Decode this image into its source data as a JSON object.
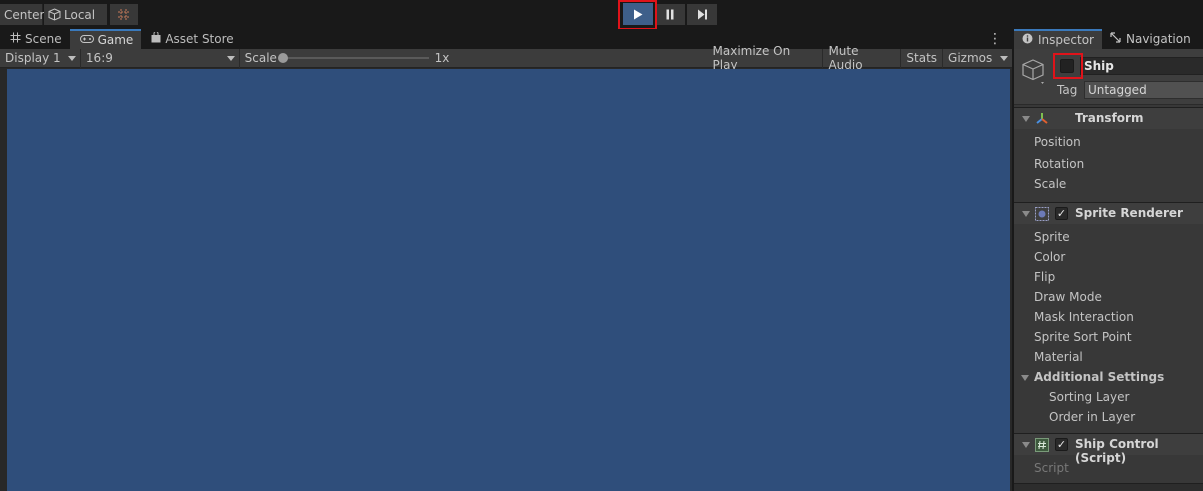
{
  "toolbar": {
    "pivot_label": "Center",
    "space_label": "Local",
    "play_state": "playing"
  },
  "game_view": {
    "tabs": [
      {
        "label": "Scene",
        "icon": "grid-icon"
      },
      {
        "label": "Game",
        "icon": "gamepad-icon",
        "active": true
      },
      {
        "label": "Asset Store",
        "icon": "shopping-bag-icon"
      }
    ],
    "display": "Display 1",
    "aspect": "16:9",
    "scale_label": "Scale",
    "scale_value": "1x",
    "buttons": [
      "Maximize On Play",
      "Mute Audio",
      "Stats",
      "Gizmos"
    ],
    "background_color": "#2f4e7b"
  },
  "inspector": {
    "tabs": [
      {
        "label": "Inspector",
        "icon": "info-icon",
        "active": true
      },
      {
        "label": "Navigation",
        "icon": "navigation-icon"
      }
    ],
    "object_name": "Ship",
    "tag_label": "Tag",
    "tag_value": "Untagged",
    "components": [
      {
        "title": "Transform",
        "icon": "transform-icon",
        "properties": [
          "Position",
          "Rotation",
          "Scale"
        ]
      },
      {
        "title": "Sprite Renderer",
        "icon": "sprite-renderer-icon",
        "enabled": true,
        "properties": [
          "Sprite",
          "Color",
          "Flip",
          "Draw Mode",
          "Mask Interaction",
          "Sprite Sort Point",
          "Material"
        ],
        "sections": [
          {
            "title": "Additional Settings",
            "properties": [
              "Sorting Layer",
              "Order in Layer"
            ]
          }
        ]
      },
      {
        "title": "Ship Control (Script)",
        "icon": "script-icon",
        "enabled": true,
        "properties": [
          "Script"
        ]
      }
    ]
  },
  "colors": {
    "accent": "#3a79bb",
    "highlight": "#e0131a",
    "play_active": "#3e5f8a"
  }
}
